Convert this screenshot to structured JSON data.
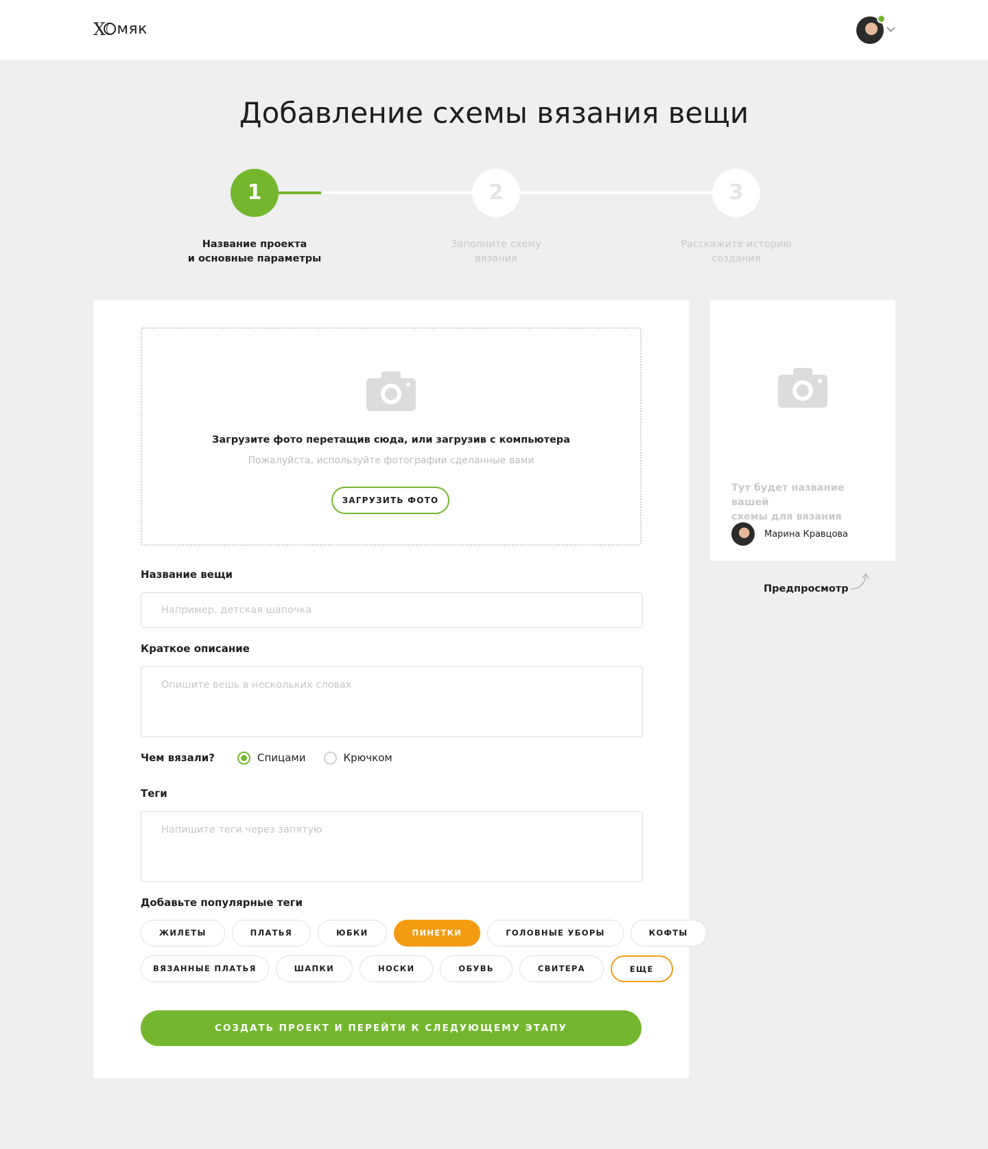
{
  "header": {
    "logo_text": "Хомяк",
    "user_online": true
  },
  "page_title": "Добавление схемы вязания вещи",
  "steps": [
    {
      "number": "1",
      "label_line1": "Название проекта",
      "label_line2": "и основные параметры",
      "active": true
    },
    {
      "number": "2",
      "label_line1": "Заполните схему",
      "label_line2": "вязания",
      "active": false
    },
    {
      "number": "3",
      "label_line1": "Расскажите историю",
      "label_line2": "создания",
      "active": false
    }
  ],
  "upload": {
    "title": "Загрузите фото перетащив сюда, или загрузив с компьютера",
    "subtitle": "Пожалуйста, используйте фотографии сделанные вами",
    "button": "ЗАГРУЗИТЬ ФОТО",
    "icon": "camera-icon"
  },
  "form": {
    "name_label": "Название вещи",
    "name_placeholder": "Например, детская шапочка",
    "desc_label": "Краткое описание",
    "desc_placeholder": "Опишите вешь в нескольких словах",
    "tool_label": "Чем вязали?",
    "tool_options": [
      {
        "label": "Спицами",
        "checked": true
      },
      {
        "label": "Крючком",
        "checked": false
      }
    ],
    "tags_label": "Теги",
    "tags_placeholder": "Напишите теги через запятую",
    "popular_label": "Добавьте популярные теги",
    "popular_tags_row1": [
      "ЖИЛЕТЫ",
      "ПЛАТЬЯ",
      "ЮБКИ",
      "ПИНЕТКИ",
      "ГОЛОВНЫЕ УБОРЫ",
      "КОФТЫ"
    ],
    "popular_tags_row2": [
      "ВЯЗАННЫЕ ПЛАТЬЯ",
      "ШАПКИ",
      "НОСКИ",
      "ОБУВЬ",
      "СВИТЕРА",
      "ЕЩЕ"
    ],
    "selected_tag": "ПИНЕТКИ",
    "submit": "СОЗДАТЬ ПРОЕКТ И ПЕРЕЙТИ К СЛЕДУЮЩЕМУ ЭТАПУ"
  },
  "preview": {
    "title_line1": "Тут будет название вашей",
    "title_line2": "схемы для вязания",
    "author": "Марина Кравцова",
    "label": "Предпросмотр"
  },
  "colors": {
    "accent_green": "#74b72e",
    "accent_orange": "#f39c12",
    "background": "#efefef"
  }
}
